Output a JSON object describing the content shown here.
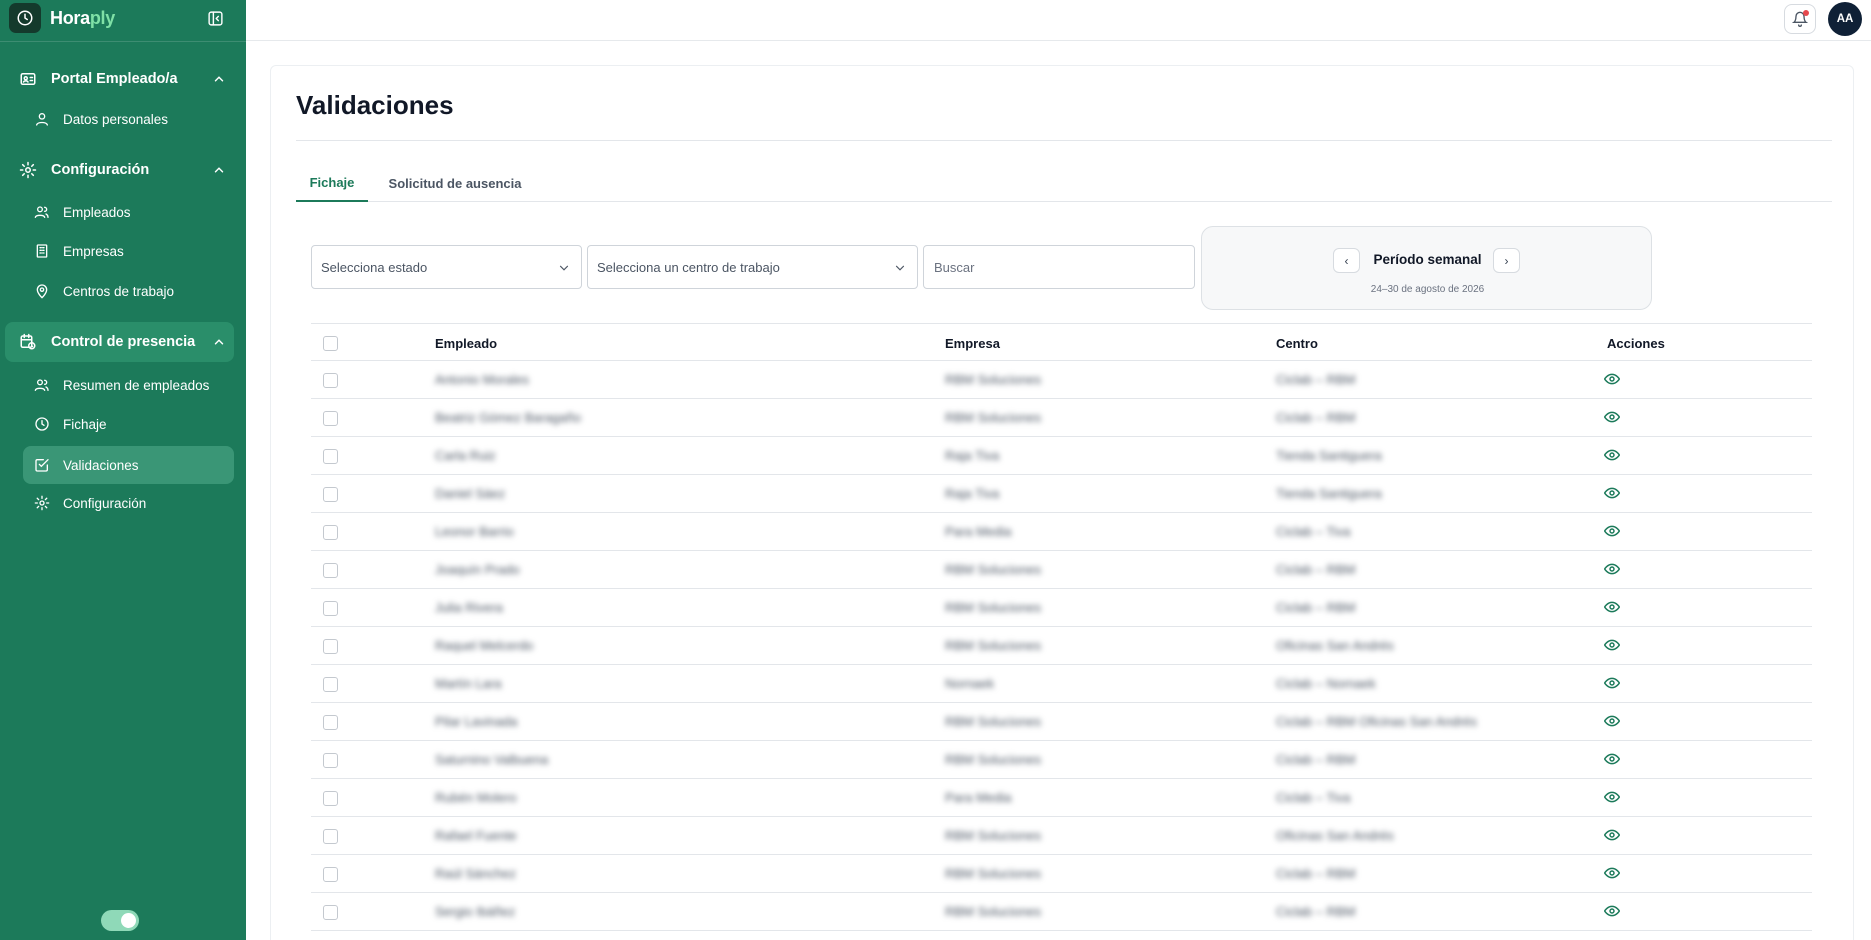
{
  "brand": {
    "part1": "Hora",
    "part2": "ply"
  },
  "sidebar": {
    "groups": [
      {
        "label": "Portal Empleado/a",
        "items": [
          {
            "label": "Datos personales"
          }
        ]
      },
      {
        "label": "Configuración",
        "items": [
          {
            "label": "Empleados"
          },
          {
            "label": "Empresas"
          },
          {
            "label": "Centros de trabajo"
          }
        ]
      },
      {
        "label": "Control de presencia",
        "items": [
          {
            "label": "Resumen de empleados"
          },
          {
            "label": "Fichaje"
          },
          {
            "label": "Validaciones"
          },
          {
            "label": "Configuración"
          }
        ]
      }
    ],
    "active_item": "Validaciones",
    "toggle_on": true
  },
  "topbar": {
    "avatar_initials": "AA",
    "has_notification": true
  },
  "page": {
    "title": "Validaciones",
    "tabs": [
      {
        "label": "Fichaje",
        "active": true
      },
      {
        "label": "Solicitud de ausencia",
        "active": false
      }
    ]
  },
  "filters": {
    "status_placeholder": "Selecciona estado",
    "center_placeholder": "Selecciona un centro de trabajo",
    "search_placeholder": "Buscar"
  },
  "period": {
    "title": "Período semanal",
    "dates": "24–30 de agosto de 2026",
    "prev": "‹",
    "next": "›"
  },
  "table": {
    "headers": {
      "employee": "Empleado",
      "company": "Empresa",
      "center": "Centro",
      "actions": "Acciones"
    },
    "rows": [
      {
        "employee": "Antonio Morales",
        "company": "RBM Soluciones",
        "center": "Ciclab – RBM"
      },
      {
        "employee": "Beatriz Gómez Baragaño",
        "company": "RBM Soluciones",
        "center": "Ciclab – RBM"
      },
      {
        "employee": "Carla Ruiz",
        "company": "Raja Tiva",
        "center": "Tienda Santiguera"
      },
      {
        "employee": "Daniel Sáez",
        "company": "Raja Tiva",
        "center": "Tienda Santiguera"
      },
      {
        "employee": "Leonor Barrio",
        "company": "Para Media",
        "center": "Ciclab – Tiva"
      },
      {
        "employee": "Joaquín Prado",
        "company": "RBM Soluciones",
        "center": "Ciclab – RBM"
      },
      {
        "employee": "Julia Rivera",
        "company": "RBM Soluciones",
        "center": "Ciclab – RBM"
      },
      {
        "employee": "Raquel Melcerdo",
        "company": "RBM Soluciones",
        "center": "Oficinas San Andrés"
      },
      {
        "employee": "Martín Lara",
        "company": "Nornaek",
        "center": "Ciclab – Nornaek"
      },
      {
        "employee": "Pilar Lavinada",
        "company": "RBM Soluciones",
        "center": "Ciclab – RBM Oficinas San Andrés"
      },
      {
        "employee": "Saturnino Valbuena",
        "company": "RBM Soluciones",
        "center": "Ciclab – RBM"
      },
      {
        "employee": "Rubén Molero",
        "company": "Para Media",
        "center": "Ciclab – Tiva"
      },
      {
        "employee": "Rafael Fuente",
        "company": "RBM Soluciones",
        "center": "Oficinas San Andrés"
      },
      {
        "employee": "Raúl Sánchez",
        "company": "RBM Soluciones",
        "center": "Ciclab – RBM"
      },
      {
        "employee": "Sergio Ibáñez",
        "company": "RBM Soluciones",
        "center": "Ciclab – RBM"
      }
    ]
  },
  "colors": {
    "sidebar": "#1c7a5a",
    "accent": "#1c7a5a",
    "brand_accent": "#7fe0a6"
  }
}
